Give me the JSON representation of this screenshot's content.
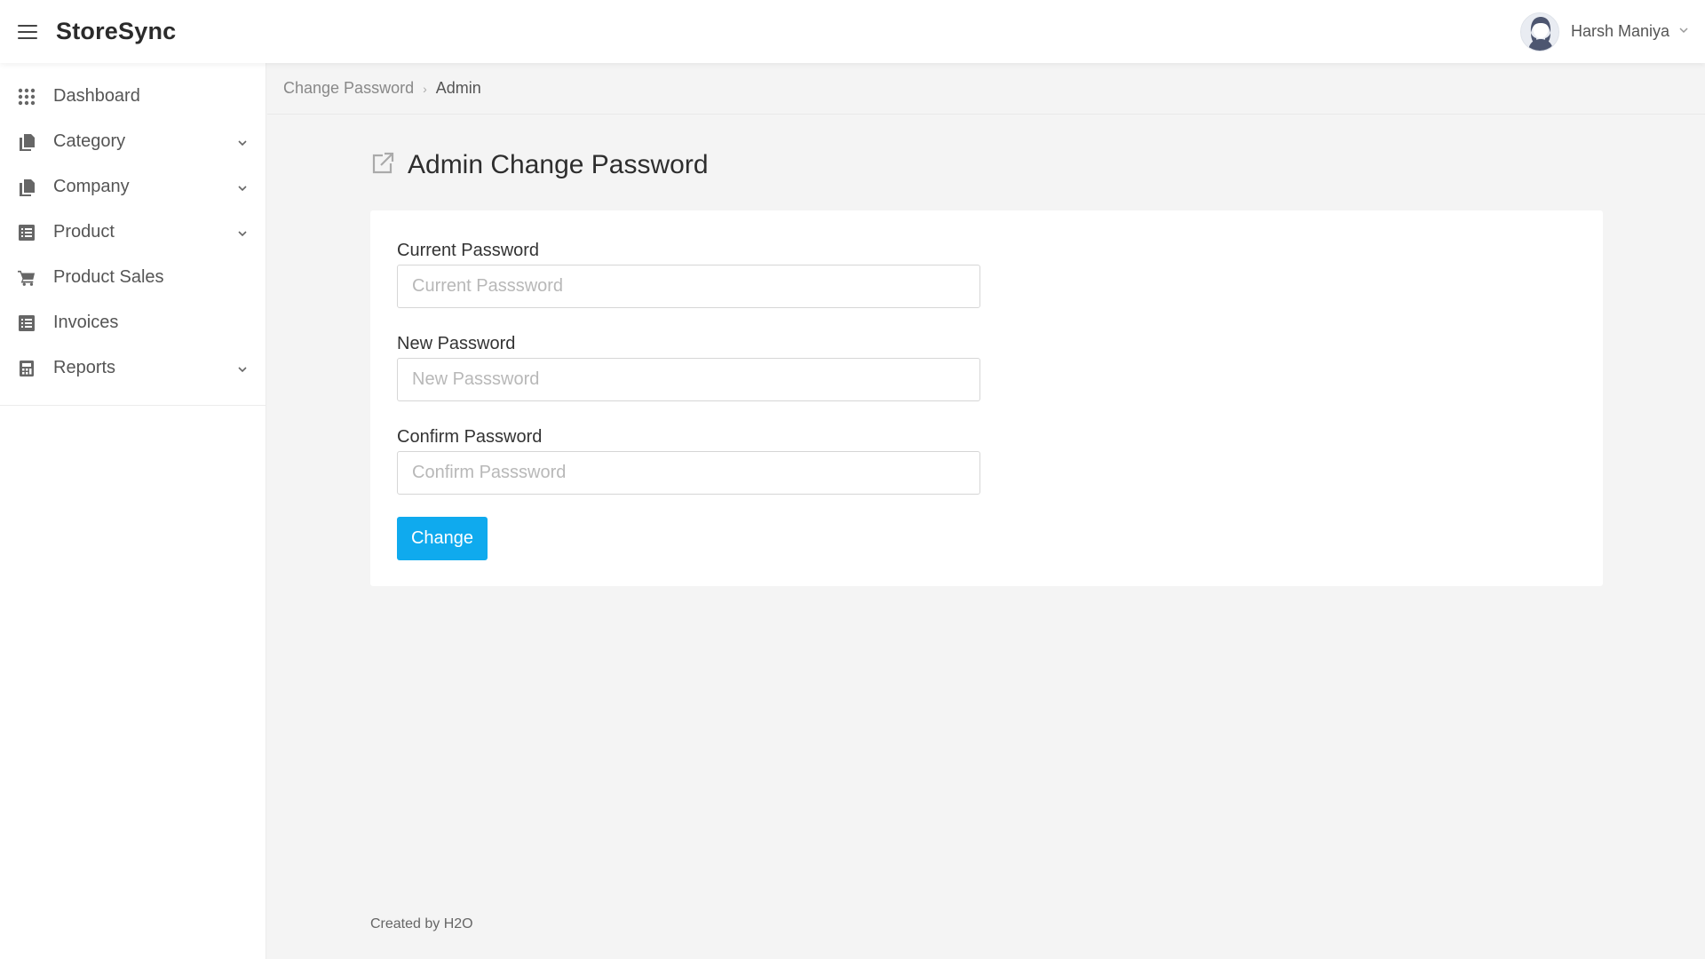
{
  "app": {
    "brand": "StoreSync"
  },
  "user": {
    "name": "Harsh Maniya",
    "status_color": "#3dbb3d"
  },
  "sidebar": {
    "items": [
      {
        "label": "Dashboard",
        "icon": "grid-icon",
        "expandable": false
      },
      {
        "label": "Category",
        "icon": "copy-icon",
        "expandable": true
      },
      {
        "label": "Company",
        "icon": "copy-icon",
        "expandable": true
      },
      {
        "label": "Product",
        "icon": "list-icon",
        "expandable": true
      },
      {
        "label": "Product Sales",
        "icon": "cart-icon",
        "expandable": false
      },
      {
        "label": "Invoices",
        "icon": "list-icon",
        "expandable": false
      },
      {
        "label": "Reports",
        "icon": "calculator-icon",
        "expandable": true
      }
    ]
  },
  "breadcrumb": {
    "parent": "Change Password",
    "current": "Admin"
  },
  "page": {
    "title": "Admin Change Password",
    "icon": "external-link-icon"
  },
  "form": {
    "current": {
      "label": "Current Password",
      "placeholder": "Current Passsword",
      "value": ""
    },
    "new": {
      "label": "New Password",
      "placeholder": "New Passsword",
      "value": ""
    },
    "confirm": {
      "label": "Confirm Password",
      "placeholder": "Confirm Passsword",
      "value": ""
    },
    "submit_label": "Change"
  },
  "footer": {
    "text": "Created by H2O"
  },
  "colors": {
    "accent": "#0faaee",
    "background": "#f4f4f4",
    "sidebar": "#ffffff"
  }
}
